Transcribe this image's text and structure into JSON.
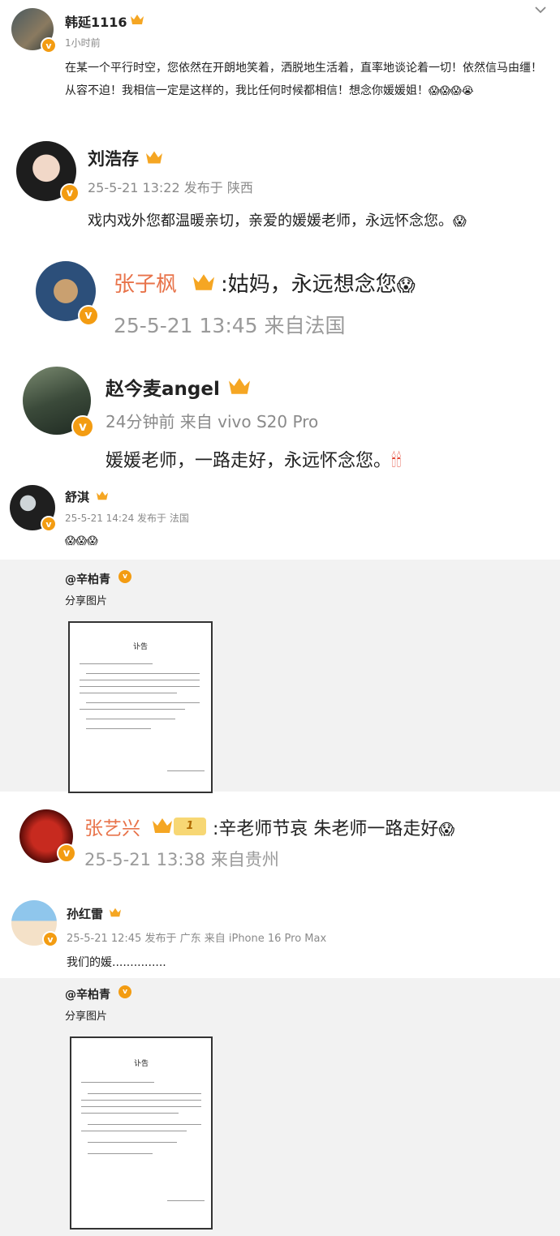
{
  "posts": [
    {
      "name": "韩延1116",
      "meta": "1小时前",
      "text": "在某一个平行时空，您依然在开朗地笑着，洒脱地生活着，直率地谈论着一切！依然信马由缰！从容不迫！我相信一定是这样的，我比任何时候都相信！想念你媛媛姐！",
      "emoji": "😱😱😱😭"
    },
    {
      "name": "刘浩存",
      "meta": "25-5-21 13:22 发布于 陕西",
      "text": "戏内戏外您都温暖亲切，亲爱的媛媛老师，永远怀念您。",
      "emoji": "😱"
    },
    {
      "name": "张子枫",
      "text": ":姑妈，永远想念您",
      "emoji": "😱",
      "meta": "25-5-21 13:45 来自法国"
    },
    {
      "name": "赵今麦angel",
      "meta": "24分钟前 来自 vivo S20 Pro",
      "text": "媛媛老师，一路走好，永远怀念您。",
      "emoji": "🕯🕯"
    },
    {
      "name": "舒淇",
      "meta": "25-5-21 14:24 发布于 法国",
      "emoji": "😱😱😱"
    },
    {
      "name": "张艺兴",
      "level": "1",
      "text": ":辛老师节哀 朱老师一路走好",
      "emoji": "😱",
      "meta": "25-5-21 13:38 来自贵州"
    },
    {
      "name": "孙红雷",
      "meta": "25-5-21 12:45 发布于 广东 来自 iPhone 16 Pro Max",
      "text": "我们的媛..............."
    }
  ],
  "shares": [
    {
      "author": "@辛柏青",
      "caption": "分享图片",
      "doc_title": "讣告"
    },
    {
      "author": "@辛柏青",
      "caption": "分享图片",
      "doc_title": "讣告"
    }
  ],
  "icons": {
    "collapse": "chevron-down",
    "verified": "v",
    "crown": "crown"
  },
  "colors": {
    "badge": "#f39c12",
    "crown": "#f5a623",
    "meta": "#8a8a8a",
    "share_bg": "#f2f2f2",
    "vip_name": "#e8734a"
  }
}
